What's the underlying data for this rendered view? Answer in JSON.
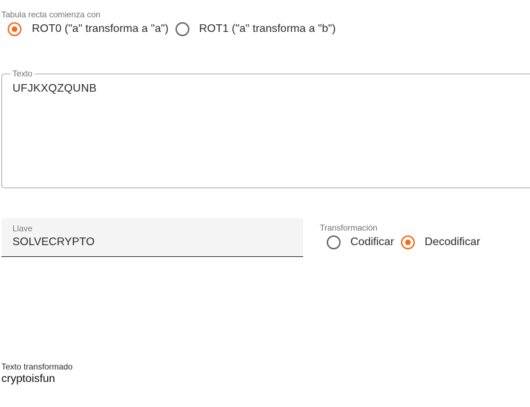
{
  "tabula": {
    "caption": "Tabula recta comienza con",
    "options": [
      {
        "label": "ROT0 (\"a\" transforma a \"a\")",
        "checked": true
      },
      {
        "label": "ROT1 (\"a\" transforma a \"b\")",
        "checked": false
      }
    ]
  },
  "texto": {
    "label": "Texto",
    "value": "UFJKXQZQUNB"
  },
  "llave": {
    "label": "Llave",
    "value": "SOLVECRYPTO"
  },
  "transformacion": {
    "caption": "Transformación",
    "options": [
      {
        "label": "Codificar",
        "checked": false
      },
      {
        "label": "Decodificar",
        "checked": true
      }
    ]
  },
  "resultado": {
    "label": "Texto transformado",
    "value": "cryptoisfun"
  },
  "colors": {
    "accent": "#ef6c1a"
  }
}
